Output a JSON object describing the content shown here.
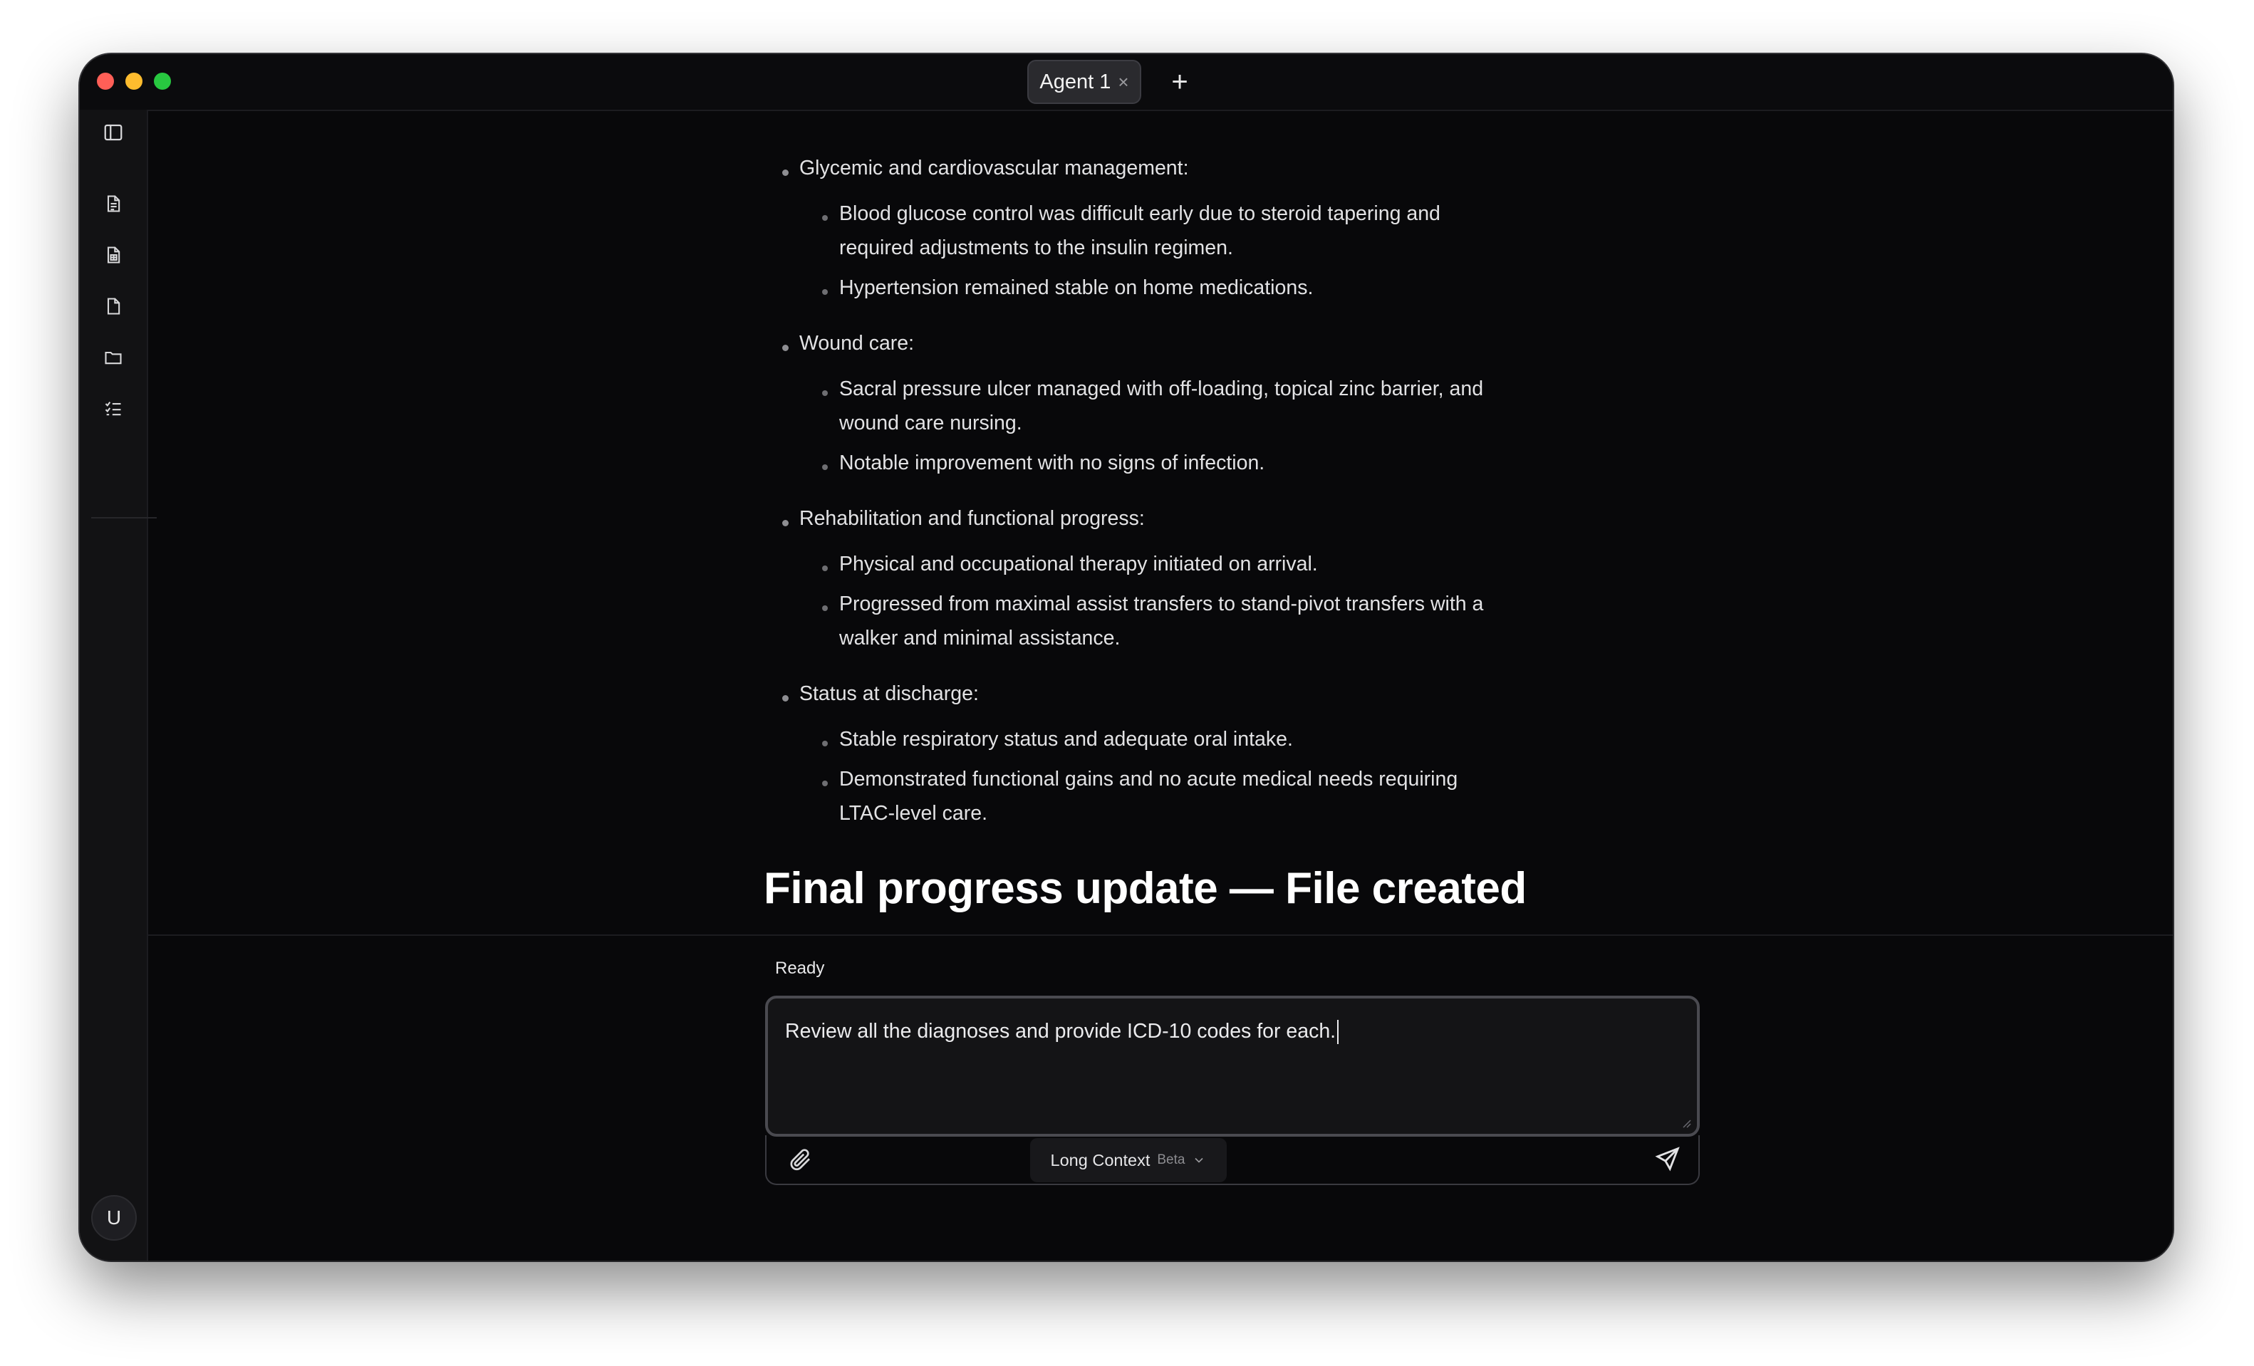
{
  "tabs": [
    {
      "label": "Agent 1",
      "close": "×"
    }
  ],
  "new_tab": "+",
  "sidebar": {
    "icons": [
      "panel-toggle-icon",
      "document-icon",
      "spreadsheet-icon",
      "file-icon",
      "folder-icon",
      "checklist-icon"
    ],
    "avatar": "U"
  },
  "document": {
    "sections": [
      {
        "title": "Glycemic and cardiovascular management:",
        "items": [
          [
            "Blood glucose control was difficult early due to steroid tapering and",
            "required adjustments to the insulin regimen."
          ],
          [
            "Hypertension remained stable on home medications."
          ]
        ]
      },
      {
        "title": "Wound care:",
        "items": [
          [
            "Sacral pressure ulcer managed with off-loading, topical zinc barrier, and",
            "wound care nursing."
          ],
          [
            "Notable improvement with no signs of infection."
          ]
        ]
      },
      {
        "title": "Rehabilitation and functional progress:",
        "items": [
          [
            "Physical and occupational therapy initiated on arrival."
          ],
          [
            "Progressed from maximal assist transfers to stand-pivot transfers with a",
            "walker and minimal assistance."
          ]
        ]
      },
      {
        "title": "Status at discharge:",
        "items": [
          [
            "Stable respiratory status and adequate oral intake."
          ],
          [
            "Demonstrated functional gains and no acute medical needs requiring",
            "LTAC-level care."
          ]
        ]
      }
    ],
    "heading": "Final progress update — File created"
  },
  "status": "Ready",
  "composer": {
    "input_value": "Review all the diagnoses and provide ICD-10 codes for each.",
    "mode_label": "Long Context",
    "mode_badge": "Beta"
  },
  "colors": {
    "background": "#08080a",
    "sidebar": "#121214",
    "text": "#e2e2e4",
    "heading": "#ffffff",
    "tab": "#2a2a2e"
  }
}
